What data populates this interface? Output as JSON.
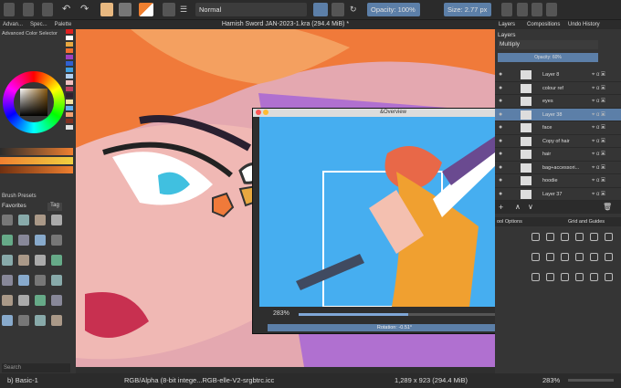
{
  "toolbar": {
    "blend_mode": "Normal",
    "opacity_label": "Opacity: 100%",
    "size_label": "Size: 2.77 px"
  },
  "left_panel": {
    "tabs": [
      "Advan...",
      "Spec...",
      "Palette"
    ],
    "color_selector_title": "Advanced Color Selector",
    "brush_presets_title": "Brush Presets",
    "tag_label": "Favorites",
    "tag_button": "Tag",
    "search_placeholder": "Search"
  },
  "window_title": "Hamish Sword JAN-2023-1.kra (294.4 MiB) *",
  "overview": {
    "title": "&Overview",
    "zoom": "283%",
    "rotation": "Rotation: -0.51°"
  },
  "right_panel": {
    "tabs": [
      "Layers",
      "Compositions",
      "Undo History"
    ],
    "section_title": "Layers",
    "blend_mode": "Multiply",
    "opacity": "Opacity:  60%",
    "layers": [
      "Layer 8",
      "colour ref",
      "eyes",
      "Layer 38",
      "face",
      "Copy of hair",
      "hair",
      "bag+accessori...",
      "hoodie",
      "Layer 37"
    ],
    "bottom_tabs": [
      "ool Options",
      "Grid and Guides"
    ]
  },
  "status": {
    "brush": "b) Basic-1",
    "color_space": "RGB/Alpha (8-bit intege...RGB-elle-V2-srgbtrc.icc",
    "dimensions": "1,289 x 923 (294.4 MiB)",
    "zoom": "283%"
  }
}
